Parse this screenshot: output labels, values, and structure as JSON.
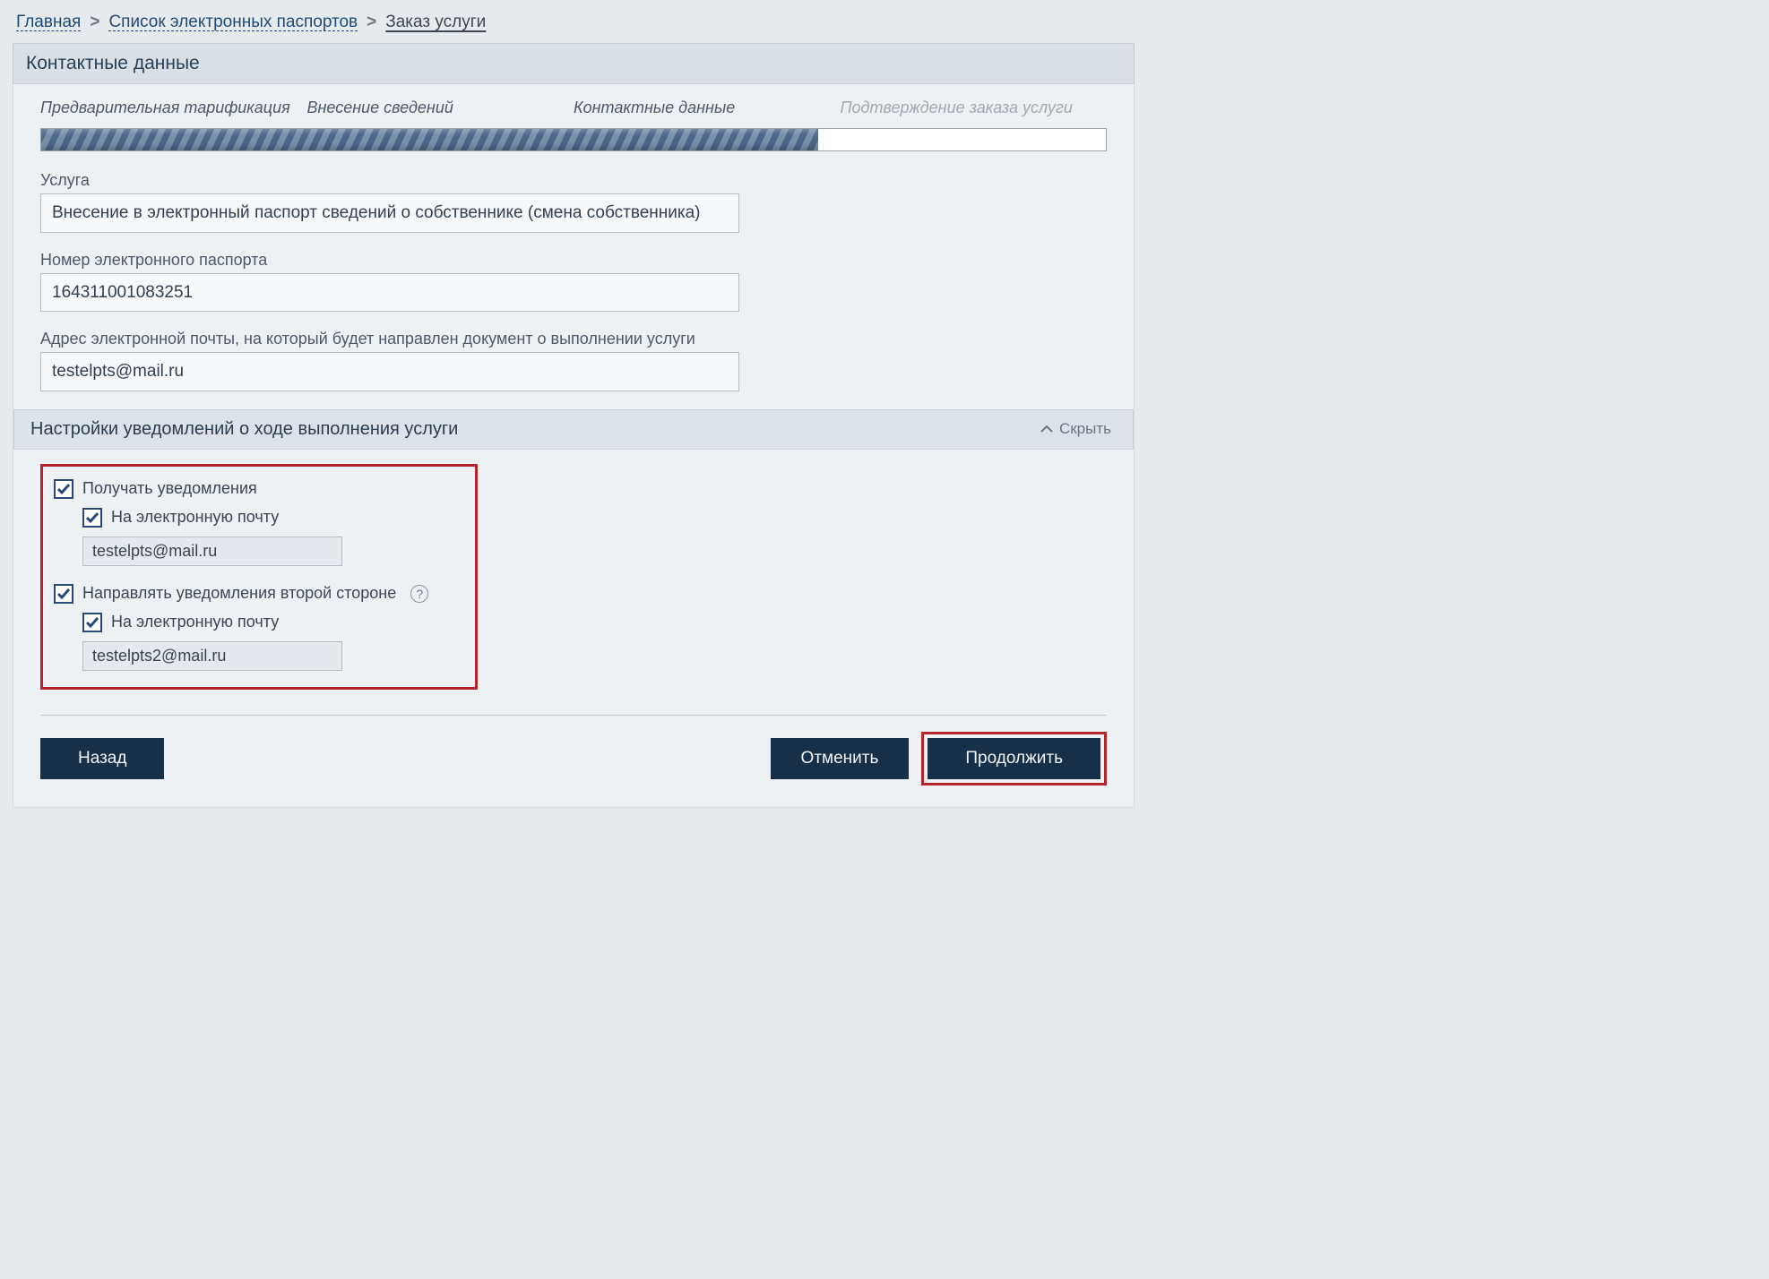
{
  "breadcrumb": {
    "home": "Главная",
    "list": "Список электронных паспортов",
    "current": "Заказ услуги"
  },
  "panel_title": "Контактные данные",
  "steps": {
    "s1": "Предварительная тарификация",
    "s2": "Внесение сведений",
    "s3": "Контактные данные",
    "s4": "Подтверждение заказа услуги"
  },
  "progress_percent": 73,
  "fields": {
    "service_label": "Услуга",
    "service_value": "Внесение в электронный паспорт сведений о собственнике (смена собственника)",
    "passport_label": "Номер электронного паспорта",
    "passport_value": "164311001083251",
    "email_label": "Адрес электронной почты, на который будет направлен документ о выполнении услуги",
    "email_value": "testelpts@mail.ru"
  },
  "notif_section": {
    "title": "Настройки уведомлений о ходе выполнения услуги",
    "toggle_label": "Скрыть",
    "receive_label": "Получать уведомления",
    "by_email_label": "На электронную почту",
    "email1": "testelpts@mail.ru",
    "send_other_label": "Направлять уведомления второй стороне",
    "email2": "testelpts2@mail.ru"
  },
  "buttons": {
    "back": "Назад",
    "cancel": "Отменить",
    "continue": "Продолжить"
  }
}
